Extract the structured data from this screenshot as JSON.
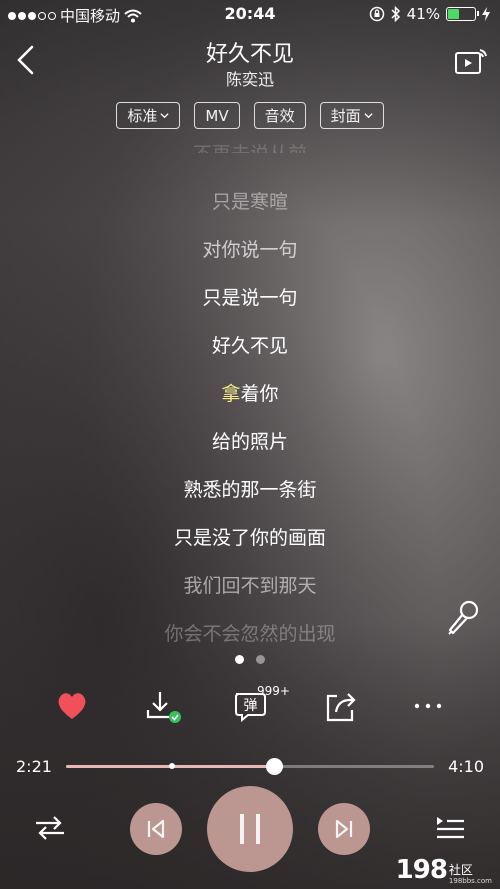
{
  "status_bar": {
    "carrier": "中国移动",
    "time": "20:44",
    "battery_percent": "41%",
    "battery_level": 0.41
  },
  "header": {
    "song_title": "好久不见",
    "artist": "陈奕迅"
  },
  "chips": [
    {
      "label": "标准",
      "dropdown": true
    },
    {
      "label": "MV",
      "dropdown": false
    },
    {
      "label": "音效",
      "dropdown": false
    },
    {
      "label": "封面",
      "dropdown": true
    }
  ],
  "lyrics": {
    "lines": [
      {
        "text": "不再去说从前",
        "state": "faint0"
      },
      {
        "text": "只是寒暄",
        "state": "faint1"
      },
      {
        "text": "对你说一句",
        "state": "faint2"
      },
      {
        "text": "只是说一句",
        "state": "bright"
      },
      {
        "text": "好久不见",
        "state": "bright"
      },
      {
        "text": "拿着你",
        "state": "current"
      },
      {
        "text": "给的照片",
        "state": "bright"
      },
      {
        "text": "熟悉的那一条街",
        "state": "bright"
      },
      {
        "text": "只是没了你的画面",
        "state": "bright"
      },
      {
        "text": "我们回不到那天",
        "state": "dim-bottom"
      },
      {
        "text": "你会不会忽然的出现",
        "state": "dim-bottom2"
      }
    ],
    "current_highlight": "拿",
    "current_rest": "着你"
  },
  "pager": {
    "pages": 2,
    "active": 0
  },
  "actions": {
    "danmaku_label": "弹",
    "danmaku_count": "999+"
  },
  "progress": {
    "current": "2:21",
    "total": "4:10",
    "played_fraction": 0.564,
    "buffer_fraction": 0.28
  },
  "colors": {
    "accent": "#c49c96",
    "heart": "#f0505a",
    "lyric_highlight": "#f6e98a",
    "download_ok": "#35c25a"
  },
  "watermark": {
    "number": "198",
    "text": "社区",
    "sub": "198bbs.com"
  }
}
